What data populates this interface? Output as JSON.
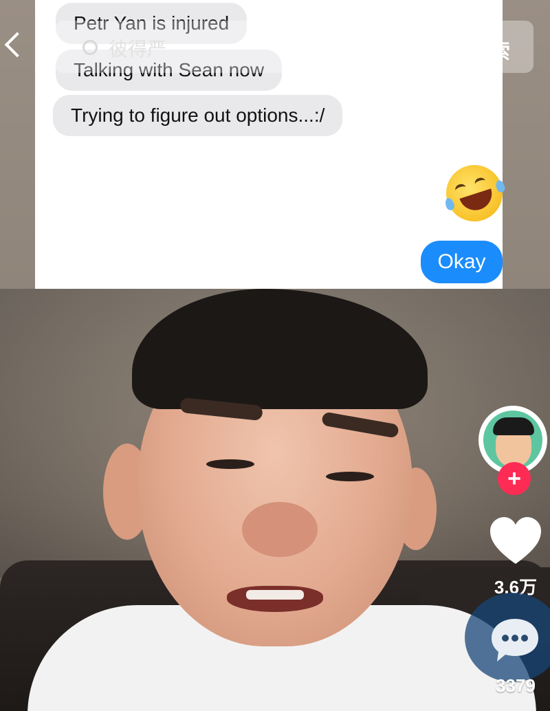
{
  "header": {
    "search_placeholder": "彼得严",
    "search_button_label": "搜索"
  },
  "chat": {
    "received_messages": [
      "Petr Yan is injured",
      "Talking with Sean now",
      "Trying to figure out options...:/"
    ],
    "sent_emoji": "rolling-on-floor-laughing",
    "sent_message": "Okay"
  },
  "actions": {
    "like_count": "3.6万",
    "comment_count": "3379"
  },
  "colors": {
    "sent_bubble": "#1b8cfb",
    "received_bubble": "#e9e9eb",
    "follow_badge": "#fe2c55"
  }
}
